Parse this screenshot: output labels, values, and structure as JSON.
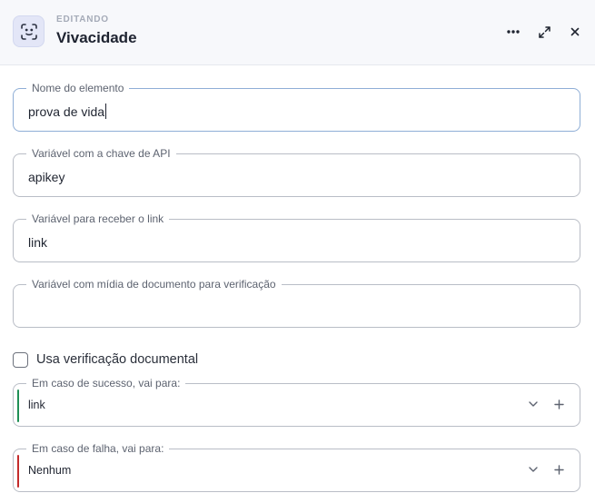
{
  "header": {
    "subtitle": "EDITANDO",
    "title": "Vivacidade",
    "icon": "face-scan-icon",
    "actions": [
      "more-icon",
      "expand-icon",
      "close-icon"
    ]
  },
  "fields": {
    "element_name": {
      "label": "Nome do elemento",
      "value": "prova de vida"
    },
    "api_key_var": {
      "label": "Variável com a chave de API",
      "value": "apikey"
    },
    "link_var": {
      "label": "Variável para receber o link",
      "value": "link"
    },
    "doc_media_var": {
      "label": "Variável com mídia de documento para verificação",
      "value": ""
    }
  },
  "checkbox": {
    "label": "Usa verificação documental",
    "checked": false
  },
  "routes": {
    "success": {
      "label": "Em caso de sucesso, vai para:",
      "value": "link",
      "accent": "#1f8f55"
    },
    "failure": {
      "label": "Em caso de falha, vai para:",
      "value": "Nenhum",
      "accent": "#c42b2b"
    }
  }
}
